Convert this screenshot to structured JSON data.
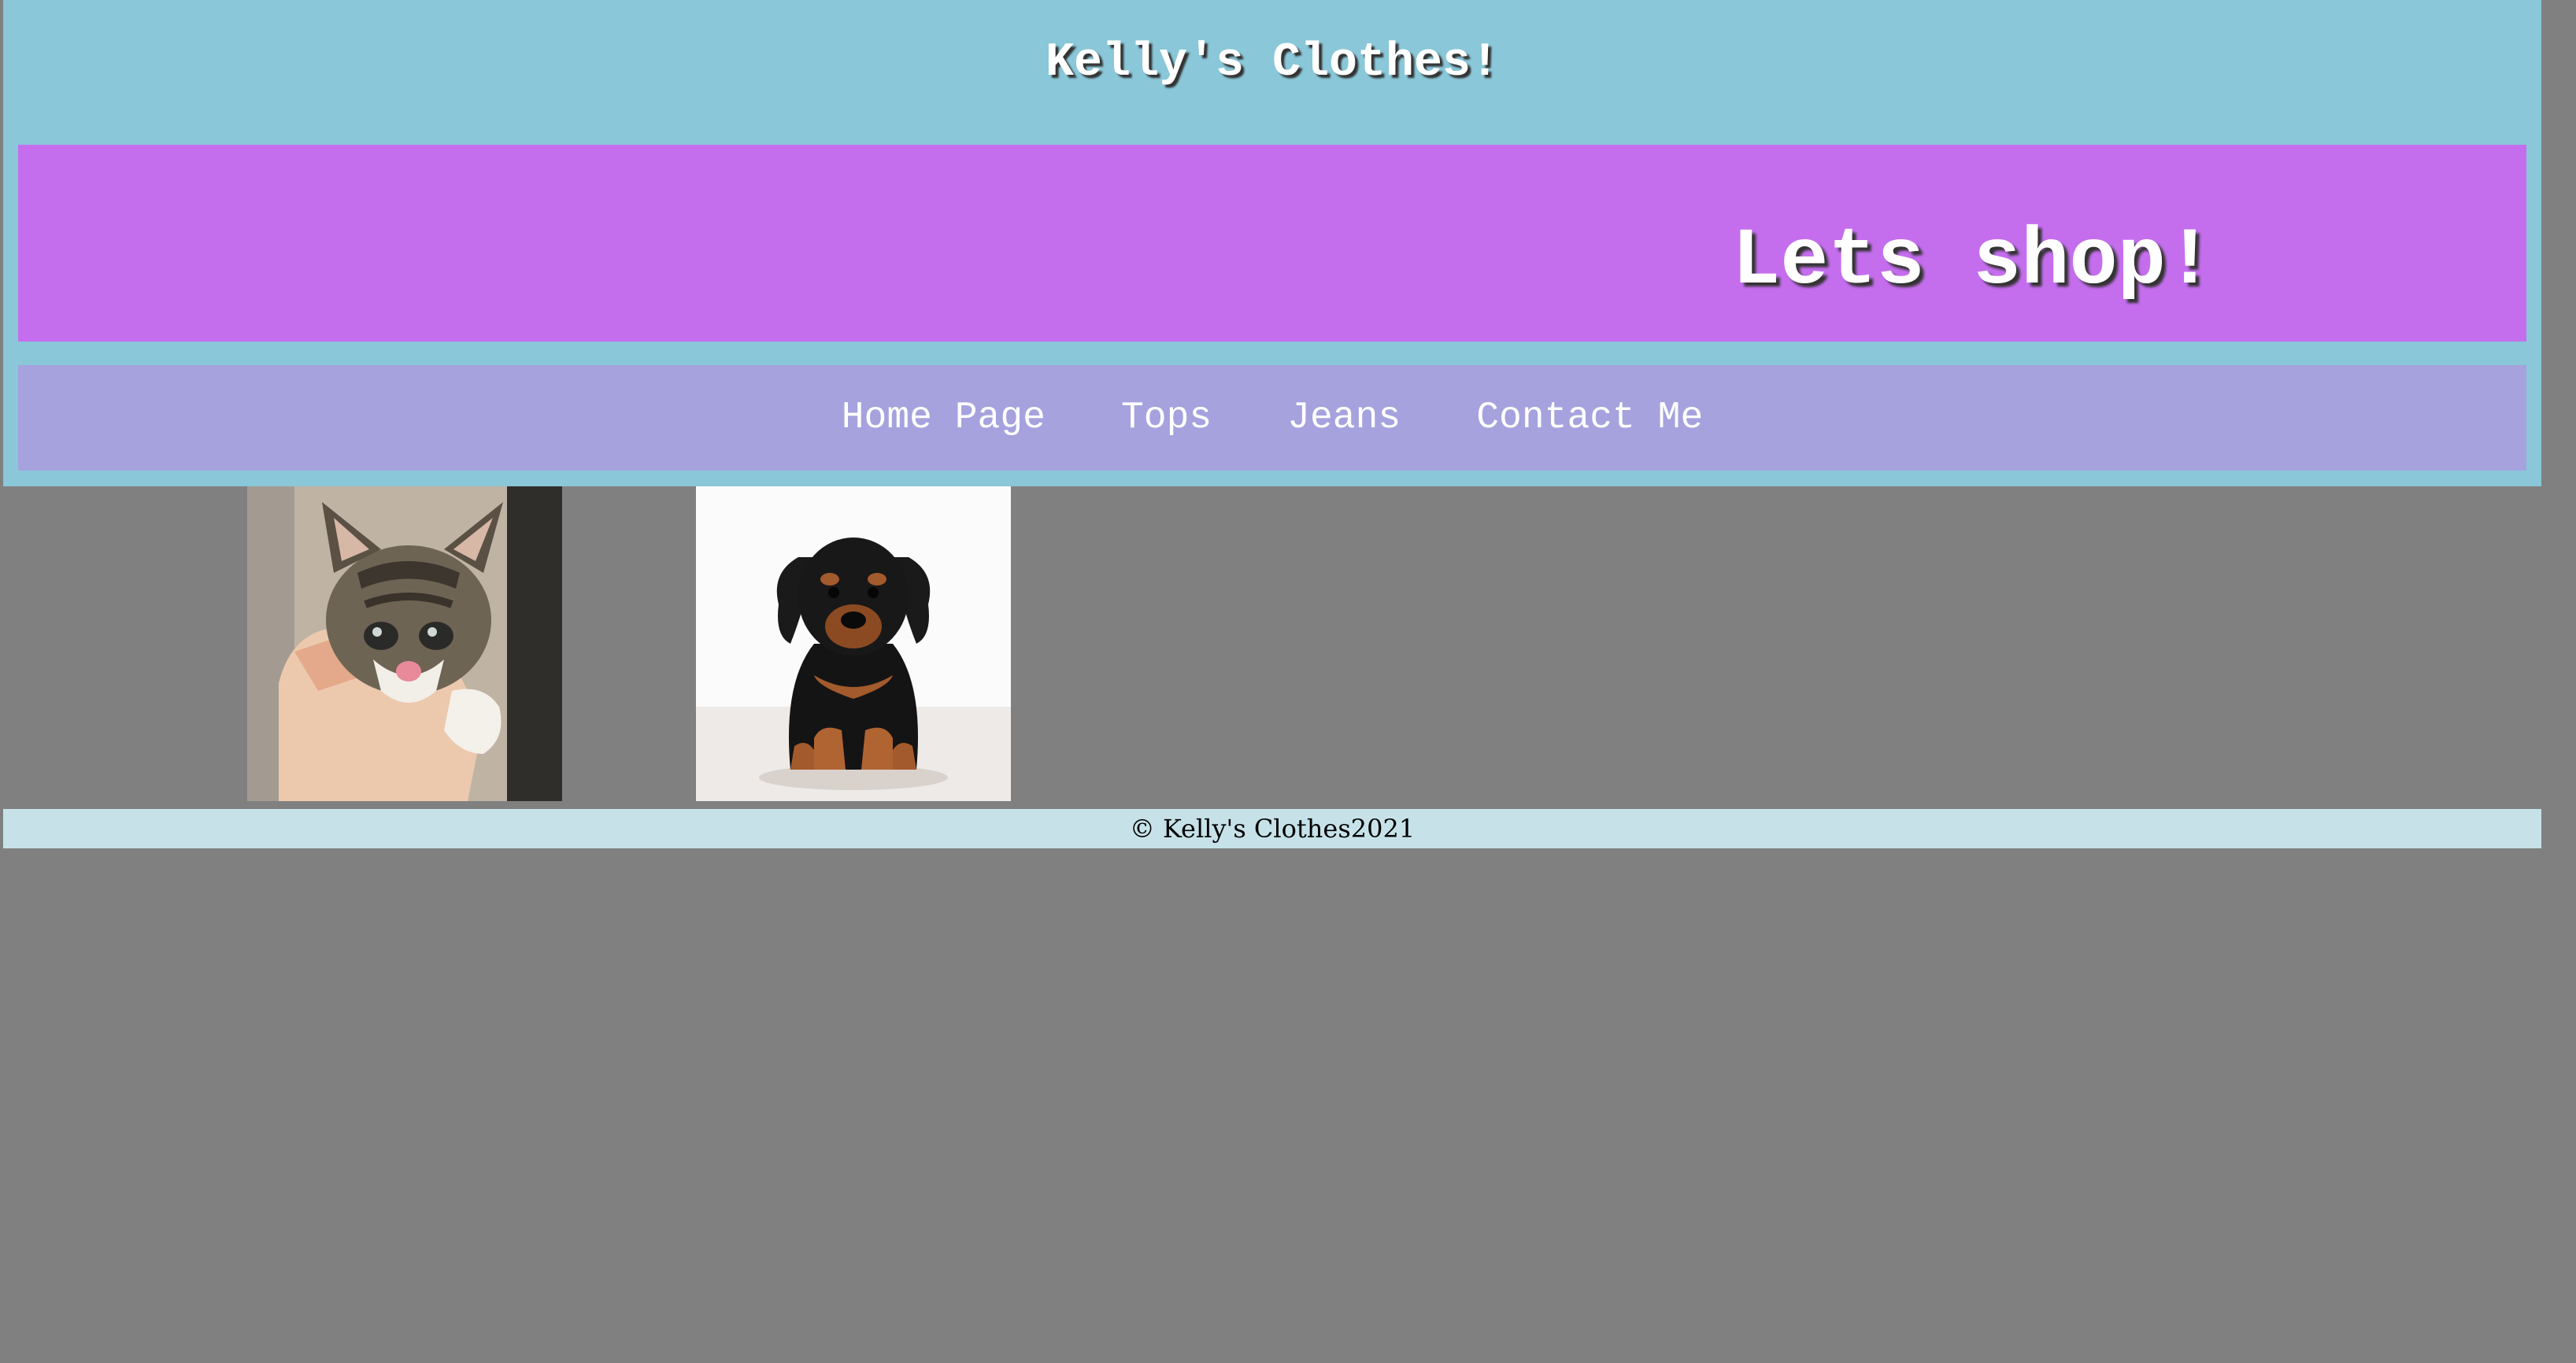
{
  "header": {
    "site_title": "Kelly's Clothes!",
    "banner_text": "Lets shop!"
  },
  "nav": {
    "items": [
      {
        "label": "Home Page"
      },
      {
        "label": "Tops"
      },
      {
        "label": "Jeans"
      },
      {
        "label": "Contact Me"
      }
    ]
  },
  "gallery": {
    "images": [
      {
        "icon": "kitten-photo"
      },
      {
        "icon": "puppy-photo"
      }
    ]
  },
  "footer": {
    "text": "© Kelly's Clothes2021"
  },
  "colors": {
    "page_background": "#808080",
    "header_background": "#89c7d9",
    "banner_background": "#c46eee",
    "nav_background": "#a5a2de",
    "footer_background": "#c6e2e8",
    "header_text": "#ffffff"
  }
}
